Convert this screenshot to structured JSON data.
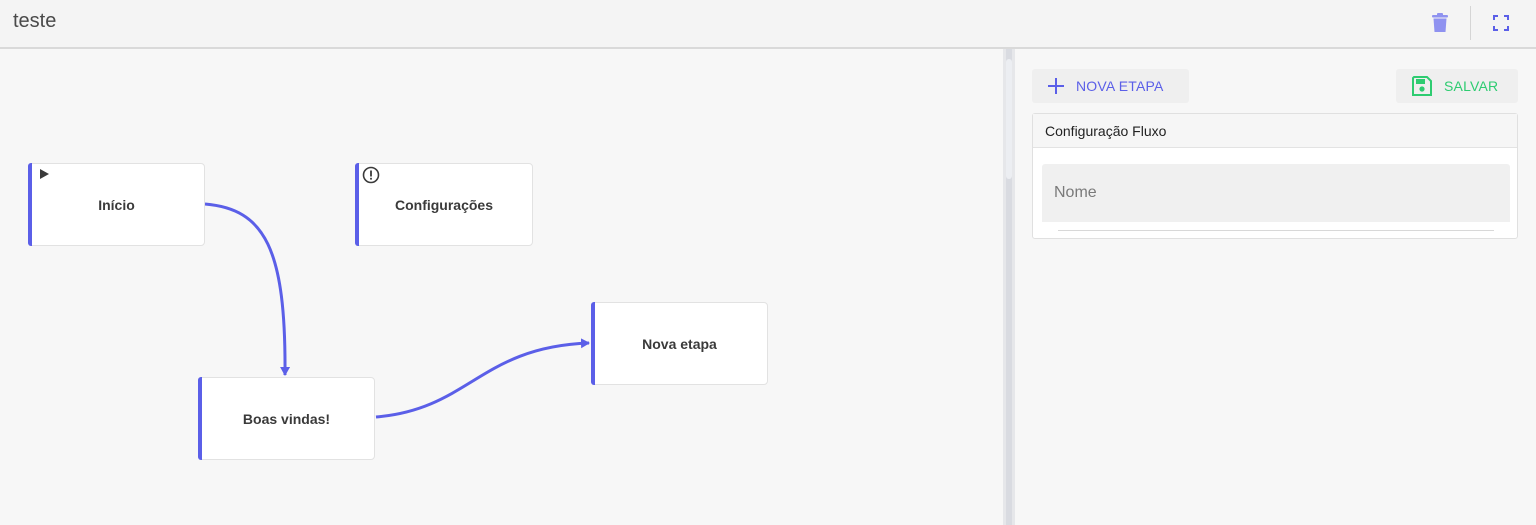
{
  "header": {
    "title": "teste",
    "delete_icon": "trash-icon",
    "fullscreen_icon": "fullscreen-icon"
  },
  "flow": {
    "nodes": [
      {
        "id": "inicio",
        "label": "Início",
        "icon": "play-icon"
      },
      {
        "id": "configuracoes",
        "label": "Configurações",
        "icon": "alert-circle-icon"
      },
      {
        "id": "boas_vindas",
        "label": "Boas vindas!"
      },
      {
        "id": "nova_etapa",
        "label": "Nova etapa"
      }
    ],
    "edges": [
      {
        "from": "inicio",
        "to": "boas_vindas"
      },
      {
        "from": "boas_vindas",
        "to": "nova_etapa"
      }
    ]
  },
  "panel": {
    "new_step_label": "NOVA ETAPA",
    "save_label": "SALVAR",
    "config_title": "Configuração Fluxo",
    "name_placeholder": "Nome",
    "name_value": ""
  },
  "colors": {
    "accent": "#5b5fe8",
    "save": "#2ecc71",
    "trash": "#8f92f0"
  }
}
